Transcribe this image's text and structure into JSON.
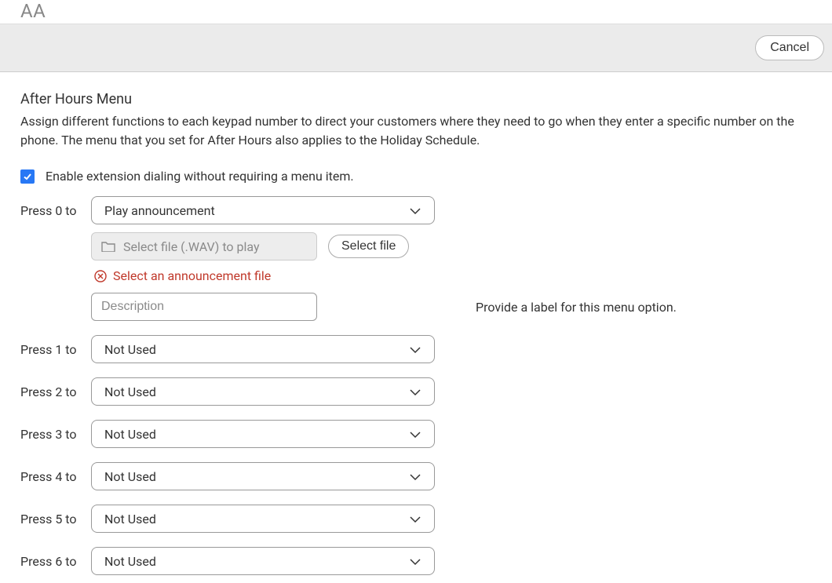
{
  "brand": "AA",
  "header": {
    "cancel": "Cancel"
  },
  "section": {
    "title": "After Hours Menu",
    "description": "Assign different functions to each keypad number to direct your customers where they need to go when they enter a specific number on the phone. The menu that you set for After Hours also applies to the Holiday Schedule."
  },
  "enableExt": {
    "checked": true,
    "label": "Enable extension dialing without requiring a menu item."
  },
  "press0": {
    "label": "Press 0 to",
    "selection": "Play announcement",
    "filePlaceholder": "Select file (.WAV) to play",
    "selectFileBtn": "Select file",
    "error": "Select an announcement file",
    "descPlaceholder": "Description",
    "descHelp": "Provide a label for this menu option."
  },
  "keypad": [
    {
      "label": "Press 1 to",
      "selection": "Not Used"
    },
    {
      "label": "Press 2 to",
      "selection": "Not Used"
    },
    {
      "label": "Press 3 to",
      "selection": "Not Used"
    },
    {
      "label": "Press 4 to",
      "selection": "Not Used"
    },
    {
      "label": "Press 5 to",
      "selection": "Not Used"
    },
    {
      "label": "Press 6 to",
      "selection": "Not Used"
    }
  ]
}
